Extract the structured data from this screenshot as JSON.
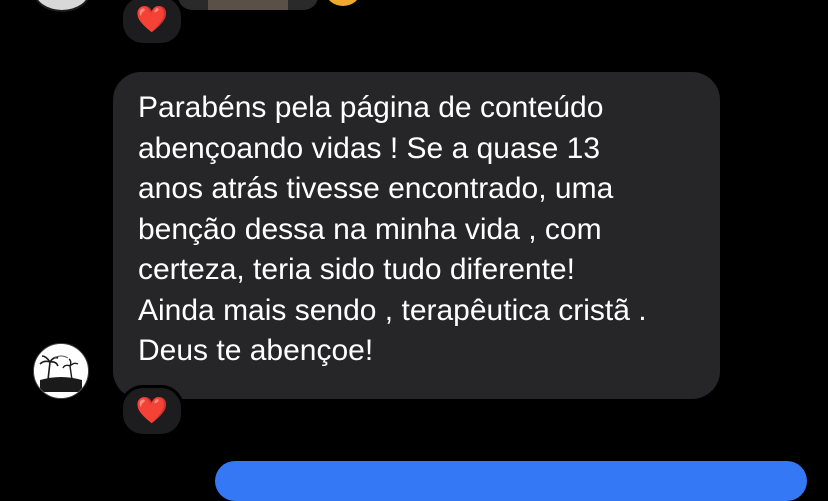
{
  "thread": {
    "previous_message": {
      "reaction_emoji": "❤️",
      "avatar_icon": "profile-avatar-icon"
    },
    "incoming_message": {
      "text": "Parabéns pela página de conteúdo\nabençoando vidas ! Se a quase 13\nanos atrás tivesse encontrado, uma\nbenção dessa na minha vida , com\ncerteza, teria sido tudo diferente!\nAinda mais sendo , terapêutica cristã .\nDeus te abençoe!",
      "reaction_emoji": "❤️",
      "avatar_icon": "profile-avatar-icon"
    }
  },
  "colors": {
    "background": "#000000",
    "incoming_bubble": "#262628",
    "outgoing_bubble": "#3478f6",
    "heart": "#e8202f",
    "text": "#ffffff"
  }
}
